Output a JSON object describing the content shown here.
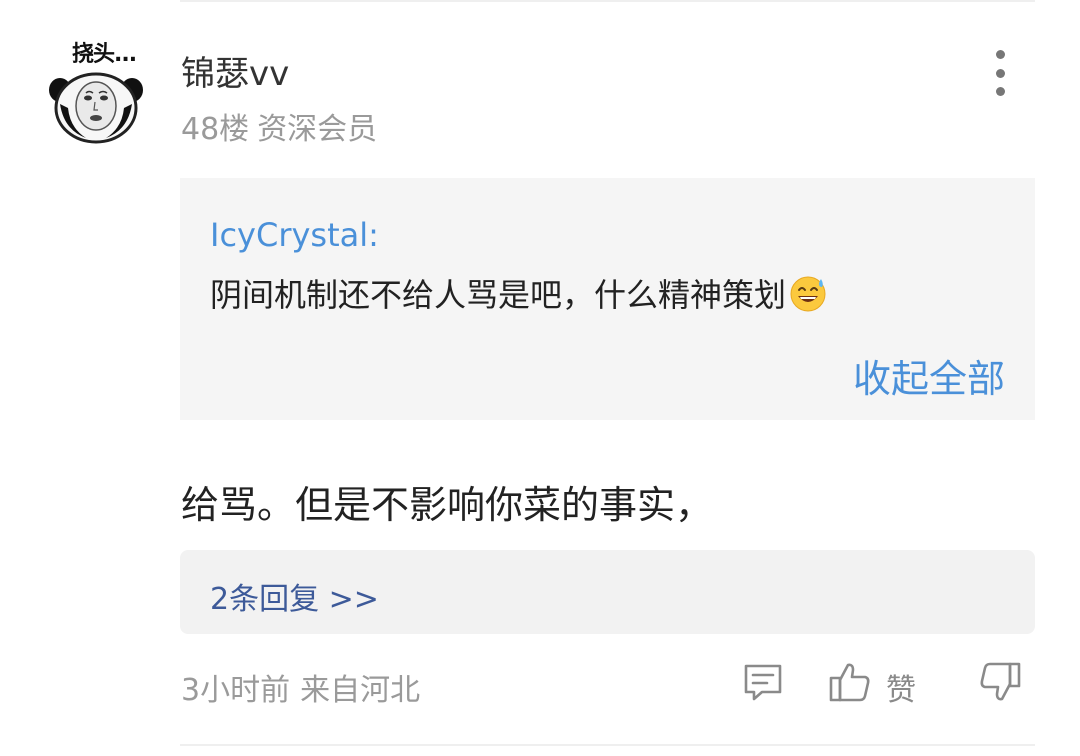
{
  "comment": {
    "avatar_caption": "挠头...",
    "username": "锦瑟vv",
    "floor": "48楼",
    "member_level": "资深会员",
    "quote": {
      "author": "IcyCrystal:",
      "text": "阴间机制还不给人骂是吧，什么精神策划",
      "collapse_label": "收起全部"
    },
    "body": "给骂。但是不影响你菜的事实，",
    "replies_label": "2条回复 >>",
    "time": "3小时前",
    "location": "来自河北",
    "like_label": "赞"
  },
  "icons": {
    "more": "more-vertical-icon",
    "reply": "comment-icon",
    "like": "thumbs-up-icon",
    "dislike": "thumbs-down-icon",
    "emoji": "sweat-smile-emoji"
  },
  "colors": {
    "link": "#4a90d9",
    "reply_link": "#3d5a99",
    "meta": "#9a9a9a",
    "quote_bg": "#f5f5f5"
  }
}
